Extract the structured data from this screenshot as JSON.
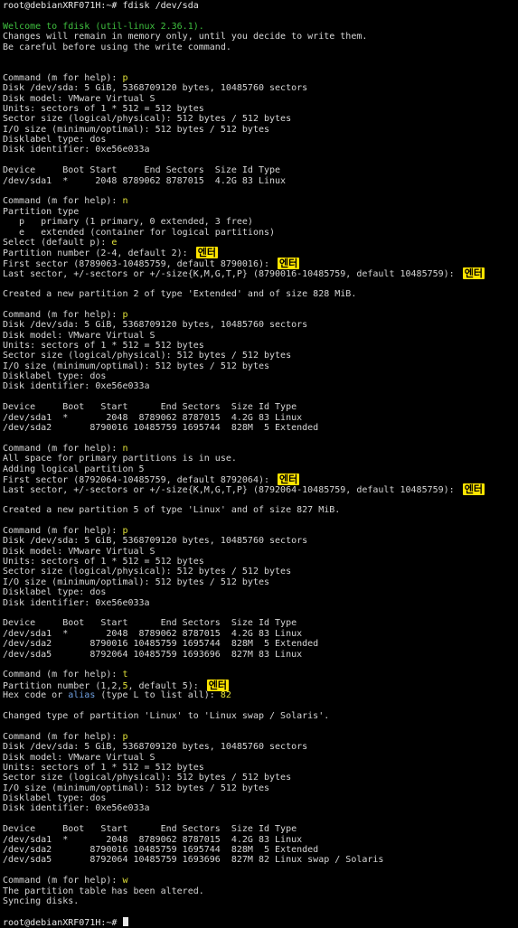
{
  "terminal": {
    "lines": [
      [
        {
          "t": "root@debianXRF071H:~# fdisk /dev/sda",
          "c": "prompt"
        }
      ],
      [],
      [
        {
          "t": "Welcome to fdisk (util-linux 2.36.1).",
          "c": "green"
        }
      ],
      [
        {
          "t": "Changes will remain in memory only, until you decide to write them."
        }
      ],
      [
        {
          "t": "Be careful before using the write command."
        }
      ],
      [],
      [],
      [
        {
          "t": "Command (m for help): "
        },
        {
          "t": "p",
          "c": "yellow"
        }
      ],
      [
        {
          "t": "Disk /dev/sda: 5 GiB, 5368709120 bytes, 10485760 sectors"
        }
      ],
      [
        {
          "t": "Disk model: VMware Virtual S"
        }
      ],
      [
        {
          "t": "Units: sectors of 1 * 512 = 512 bytes"
        }
      ],
      [
        {
          "t": "Sector size (logical/physical): 512 bytes / 512 bytes"
        }
      ],
      [
        {
          "t": "I/O size (minimum/optimal): 512 bytes / 512 bytes"
        }
      ],
      [
        {
          "t": "Disklabel type: dos"
        }
      ],
      [
        {
          "t": "Disk identifier: 0xe56e033a"
        }
      ],
      [],
      [
        {
          "t": "Device     Boot Start     End Sectors  Size Id Type"
        }
      ],
      [
        {
          "t": "/dev/sda1  *     2048 8789062 8787015  4.2G 83 Linux"
        }
      ],
      [],
      [
        {
          "t": "Command (m for help): "
        },
        {
          "t": "n",
          "c": "yellow"
        }
      ],
      [
        {
          "t": "Partition type"
        }
      ],
      [
        {
          "t": "   p   primary (1 primary, 0 extended, 3 free)"
        }
      ],
      [
        {
          "t": "   e   extended (container for logical partitions)"
        }
      ],
      [
        {
          "t": "Select (default p): "
        },
        {
          "t": "e",
          "c": "yellow"
        }
      ],
      [
        {
          "t": "Partition number (2-4, default 2): "
        },
        {
          "t": "엔터",
          "c": "enter"
        }
      ],
      [
        {
          "t": "First sector (8789063-10485759, default 8790016): "
        },
        {
          "t": "엔터",
          "c": "enter"
        }
      ],
      [
        {
          "t": "Last sector, +/-sectors or +/-size{K,M,G,T,P} (8790016-10485759, default 10485759): "
        },
        {
          "t": "엔터",
          "c": "enter"
        }
      ],
      [],
      [
        {
          "t": "Created a new partition 2 of type 'Extended' and of size 828 MiB."
        }
      ],
      [],
      [
        {
          "t": "Command (m for help): "
        },
        {
          "t": "p",
          "c": "yellow"
        }
      ],
      [
        {
          "t": "Disk /dev/sda: 5 GiB, 5368709120 bytes, 10485760 sectors"
        }
      ],
      [
        {
          "t": "Disk model: VMware Virtual S"
        }
      ],
      [
        {
          "t": "Units: sectors of 1 * 512 = 512 bytes"
        }
      ],
      [
        {
          "t": "Sector size (logical/physical): 512 bytes / 512 bytes"
        }
      ],
      [
        {
          "t": "I/O size (minimum/optimal): 512 bytes / 512 bytes"
        }
      ],
      [
        {
          "t": "Disklabel type: dos"
        }
      ],
      [
        {
          "t": "Disk identifier: 0xe56e033a"
        }
      ],
      [],
      [
        {
          "t": "Device     Boot   Start      End Sectors  Size Id Type"
        }
      ],
      [
        {
          "t": "/dev/sda1  *       2048  8789062 8787015  4.2G 83 Linux"
        }
      ],
      [
        {
          "t": "/dev/sda2       8790016 10485759 1695744  828M  5 Extended"
        }
      ],
      [],
      [
        {
          "t": "Command (m for help): "
        },
        {
          "t": "n",
          "c": "yellow"
        }
      ],
      [
        {
          "t": "All space for primary partitions is in use."
        }
      ],
      [
        {
          "t": "Adding logical partition 5"
        }
      ],
      [
        {
          "t": "First sector (8792064-10485759, default 8792064): "
        },
        {
          "t": "엔터",
          "c": "enter"
        }
      ],
      [
        {
          "t": "Last sector, +/-sectors or +/-size{K,M,G,T,P} (8792064-10485759, default 10485759): "
        },
        {
          "t": "엔터",
          "c": "enter"
        }
      ],
      [],
      [
        {
          "t": "Created a new partition 5 of type 'Linux' and of size 827 MiB."
        }
      ],
      [],
      [
        {
          "t": "Command (m for help): "
        },
        {
          "t": "p",
          "c": "yellow"
        }
      ],
      [
        {
          "t": "Disk /dev/sda: 5 GiB, 5368709120 bytes, 10485760 sectors"
        }
      ],
      [
        {
          "t": "Disk model: VMware Virtual S"
        }
      ],
      [
        {
          "t": "Units: sectors of 1 * 512 = 512 bytes"
        }
      ],
      [
        {
          "t": "Sector size (logical/physical): 512 bytes / 512 bytes"
        }
      ],
      [
        {
          "t": "I/O size (minimum/optimal): 512 bytes / 512 bytes"
        }
      ],
      [
        {
          "t": "Disklabel type: dos"
        }
      ],
      [
        {
          "t": "Disk identifier: 0xe56e033a"
        }
      ],
      [],
      [
        {
          "t": "Device     Boot   Start      End Sectors  Size Id Type"
        }
      ],
      [
        {
          "t": "/dev/sda1  *       2048  8789062 8787015  4.2G 83 Linux"
        }
      ],
      [
        {
          "t": "/dev/sda2       8790016 10485759 1695744  828M  5 Extended"
        }
      ],
      [
        {
          "t": "/dev/sda5       8792064 10485759 1693696  827M 83 Linux"
        }
      ],
      [],
      [
        {
          "t": "Command (m for help): "
        },
        {
          "t": "t",
          "c": "yellow"
        }
      ],
      [
        {
          "t": "Partition number (1,2,"
        },
        {
          "t": "5",
          "c": "yellow"
        },
        {
          "t": ", default 5): "
        },
        {
          "t": "엔터",
          "c": "enter"
        }
      ],
      [
        {
          "t": "Hex code or "
        },
        {
          "t": "alias",
          "c": "blue"
        },
        {
          "t": " (type L to list all): "
        },
        {
          "t": "82",
          "c": "yellow"
        }
      ],
      [],
      [
        {
          "t": "Changed type of partition 'Linux' to 'Linux swap / Solaris'."
        }
      ],
      [],
      [
        {
          "t": "Command (m for help): "
        },
        {
          "t": "p",
          "c": "yellow"
        }
      ],
      [
        {
          "t": "Disk /dev/sda: 5 GiB, 5368709120 bytes, 10485760 sectors"
        }
      ],
      [
        {
          "t": "Disk model: VMware Virtual S"
        }
      ],
      [
        {
          "t": "Units: sectors of 1 * 512 = 512 bytes"
        }
      ],
      [
        {
          "t": "Sector size (logical/physical): 512 bytes / 512 bytes"
        }
      ],
      [
        {
          "t": "I/O size (minimum/optimal): 512 bytes / 512 bytes"
        }
      ],
      [
        {
          "t": "Disklabel type: dos"
        }
      ],
      [
        {
          "t": "Disk identifier: 0xe56e033a"
        }
      ],
      [],
      [
        {
          "t": "Device     Boot   Start      End Sectors  Size Id Type"
        }
      ],
      [
        {
          "t": "/dev/sda1  *       2048  8789062 8787015  4.2G 83 Linux"
        }
      ],
      [
        {
          "t": "/dev/sda2       8790016 10485759 1695744  828M  5 Extended"
        }
      ],
      [
        {
          "t": "/dev/sda5       8792064 10485759 1693696  827M 82 Linux swap / Solaris"
        }
      ],
      [],
      [
        {
          "t": "Command (m for help): "
        },
        {
          "t": "w",
          "c": "yellow"
        }
      ],
      [
        {
          "t": "The partition table has been altered."
        }
      ],
      [
        {
          "t": "Syncing disks."
        }
      ],
      [],
      [
        {
          "t": "root@debianXRF071H:~# ",
          "c": "prompt"
        },
        {
          "t": "",
          "c": "cursor"
        }
      ]
    ]
  },
  "colors": {
    "background": "#000000",
    "text": "#d6d6d6",
    "user_input": "#e2e23a",
    "welcome": "#3fc03f",
    "annotation_bg": "#ffe400"
  }
}
